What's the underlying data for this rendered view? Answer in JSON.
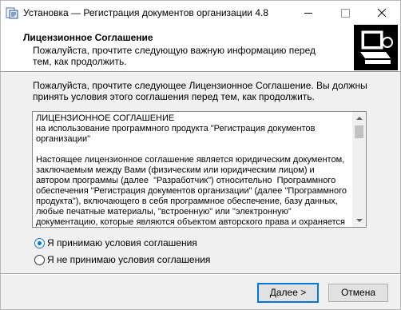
{
  "window": {
    "title": "Установка — Регистрация документов организации 4.8"
  },
  "header": {
    "title": "Лицензионное Соглашение",
    "subtitle": "Пожалуйста, прочтите следующую важную информацию перед тем, как продолжить."
  },
  "main": {
    "intro": "Пожалуйста, прочтите следующее Лицензионное Соглашение. Вы должны принять условия этого соглашения перед тем, как продолжить.",
    "license_text": "ЛИЦЕНЗИОННОЕ СОГЛАШЕНИЕ\nна использование программного продукта \"Регистрация документов организации\"\n\nНастоящее лицензионное соглашение является юридическим документом, заключаемым между Вами (физическим или юридическим лицом) и автором программы (далее  \"Разработчик\") относительно  Программного обеспечения \"Регистрация документов организации\" (далее \"Программного продукта\"), включающего в себя программное обеспечение, базу данных, любые печатные материалы, \"встроенную\" или \"электронную\" документацию, которые являются объектом авторского права и охраняется законом."
  },
  "options": {
    "accept_label": "Я принимаю условия соглашения",
    "decline_label": "Я не принимаю условия соглашения",
    "selected": "accept"
  },
  "buttons": {
    "next_label": "Далее >",
    "cancel_label": "Отмена"
  },
  "colors": {
    "accent": "#0078d7"
  }
}
